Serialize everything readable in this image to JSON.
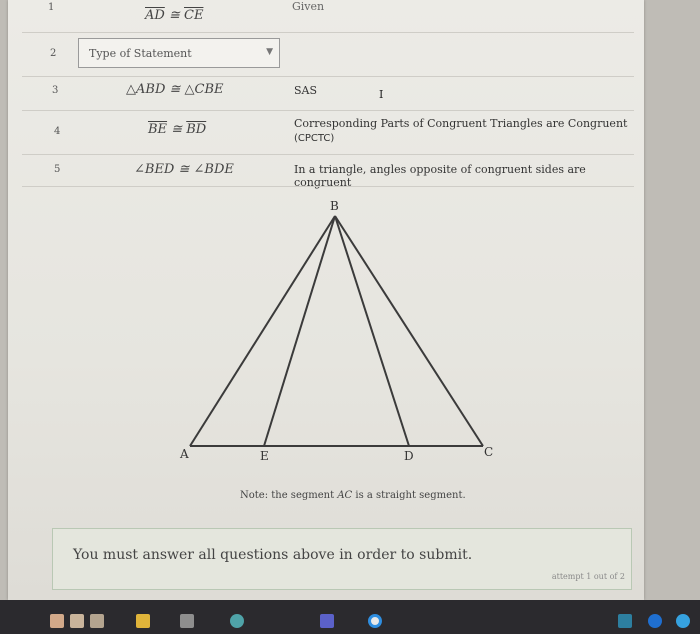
{
  "table": {
    "rows": [
      {
        "num": "1",
        "stmt_a": "AD",
        "op": "≅",
        "stmt_b": "CE",
        "reason": "Given"
      },
      {
        "num": "2",
        "dropdown_placeholder": "Type of Statement"
      },
      {
        "num": "3",
        "statement": "△ABD ≅ △CBE",
        "reason": "SAS"
      },
      {
        "num": "4",
        "stmt_a": "BE",
        "op": "≅",
        "stmt_b": "BD",
        "reason_line1": "Corresponding Parts of Congruent Triangles are Congruent",
        "reason_line2": "(CPCTC)"
      },
      {
        "num": "5",
        "statement": "∠BED ≅ ∠BDE",
        "reason": "In a triangle, angles opposite of congruent sides are congruent"
      }
    ]
  },
  "diagram": {
    "points": {
      "A": "A",
      "B": "B",
      "C": "C",
      "D": "D",
      "E": "E"
    }
  },
  "note": {
    "prefix": "Note: the segment ",
    "segment": "AC",
    "suffix": " is a straight segment."
  },
  "submit": {
    "message": "You must answer all questions above in order to submit.",
    "attempt": "attempt 1 out of 2"
  },
  "cursor": "I",
  "taskbar": {
    "icons": [
      "app-icon",
      "app-icon",
      "app-icon",
      "file-explorer-icon",
      "calculator-icon",
      "edge-icon",
      "teams-icon",
      "chrome-icon",
      "tray-icon",
      "tray-icon",
      "tray-icon"
    ]
  }
}
